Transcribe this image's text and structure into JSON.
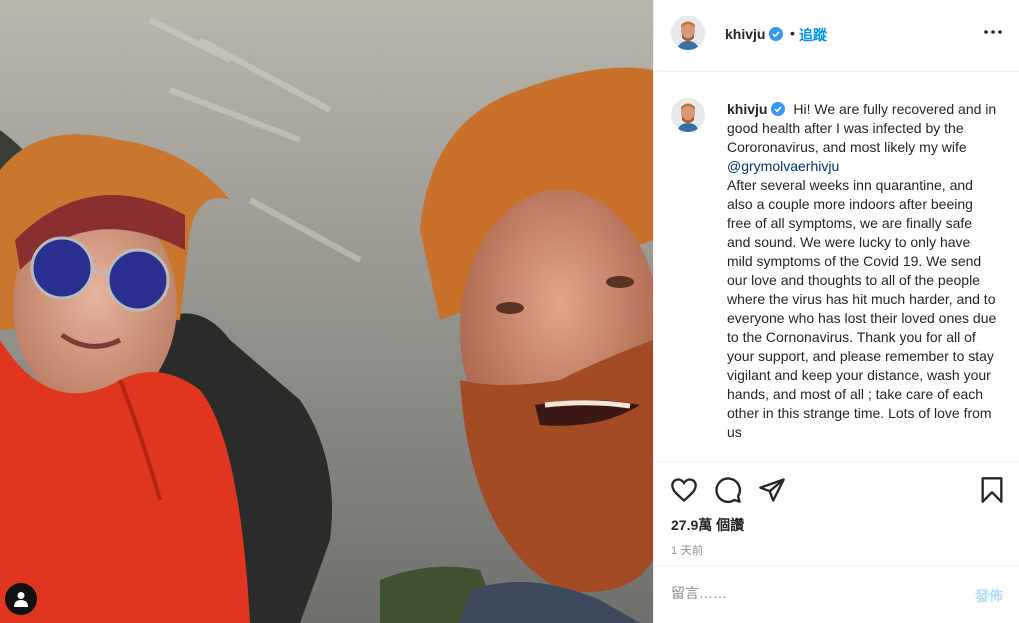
{
  "post": {
    "photo_alt": "",
    "tag_icon": "user-tag-icon"
  },
  "header": {
    "username": "khivju",
    "dot": "•",
    "follow_label": "追蹤",
    "more_icon": "more-options-icon"
  },
  "caption": {
    "username": "khivju",
    "text_part1": "Hi! We are fully recovered and in good health after I was infected by the Cororonavirus, and most likely my wife ",
    "mention": "@grymolvaerhivju",
    "text_part2": "After several weeks inn quarantine, and also a couple more indoors after beeing free of all symptoms, we are finally safe and sound. We were lucky to only have mild symptoms of the Covid 19. We send our love and thoughts to all of the people where the virus has hit much harder, and to everyone who has lost their loved ones due to the Cornonavirus. Thank you for all of your support, and please remember to stay vigilant and keep your distance, wash your hands, and most of all ; take care of each other in this strange time. Lots of love from us"
  },
  "actions": {
    "like_icon": "heart-icon",
    "comment_icon": "comment-icon",
    "share_icon": "share-icon",
    "save_icon": "bookmark-icon"
  },
  "likes": "27.9萬 個讚",
  "time_ago": "1 天前",
  "comment": {
    "placeholder": "留言……",
    "post_label": "發佈"
  },
  "colors": {
    "accent": "#0095f6",
    "post_disabled": "#b2dffc",
    "verified": "#3897f0"
  }
}
